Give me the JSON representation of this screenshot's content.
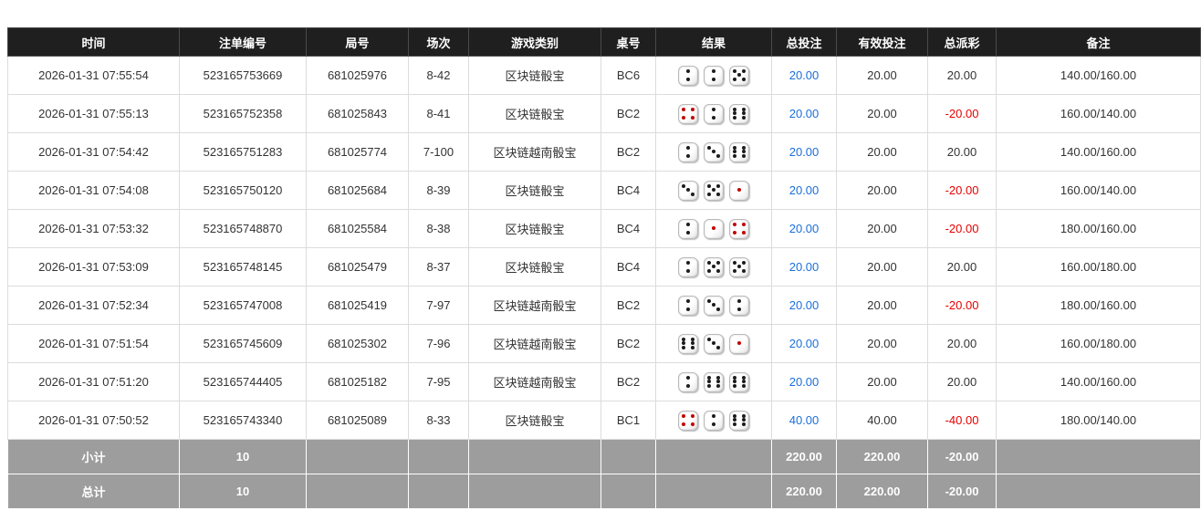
{
  "colors": {
    "header_bg": "#1f1f1f",
    "header_text": "#ffffff",
    "footer_bg": "#9d9d9d",
    "footer_text": "#ffffff",
    "bet_link_blue": "#1a6fd9",
    "negative_red": "#e60000",
    "body_text": "#333333"
  },
  "table": {
    "columns": [
      {
        "label": "时间"
      },
      {
        "label": "注单编号"
      },
      {
        "label": "局号"
      },
      {
        "label": "场次"
      },
      {
        "label": "游戏类别"
      },
      {
        "label": "桌号"
      },
      {
        "label": "结果"
      },
      {
        "label": "总投注"
      },
      {
        "label": "有效投注"
      },
      {
        "label": "总派彩"
      },
      {
        "label": "备注"
      }
    ],
    "rows": [
      {
        "time": "2026-01-31 07:55:54",
        "bet_id": "523165753669",
        "round_id": "681025976",
        "session": "8-42",
        "game_type": "区块链骰宝",
        "table_no": "BC6",
        "dice": [
          {
            "value": 2,
            "color": "black"
          },
          {
            "value": 2,
            "color": "black"
          },
          {
            "value": 5,
            "color": "black"
          }
        ],
        "total_bet": "20.00",
        "valid_bet": "20.00",
        "payout": "20.00",
        "remark": "140.00/160.00"
      },
      {
        "time": "2026-01-31 07:55:13",
        "bet_id": "523165752358",
        "round_id": "681025843",
        "session": "8-41",
        "game_type": "区块链骰宝",
        "table_no": "BC2",
        "dice": [
          {
            "value": 4,
            "color": "red"
          },
          {
            "value": 2,
            "color": "black"
          },
          {
            "value": 6,
            "color": "black"
          }
        ],
        "total_bet": "20.00",
        "valid_bet": "20.00",
        "payout": "-20.00",
        "remark": "160.00/140.00"
      },
      {
        "time": "2026-01-31 07:54:42",
        "bet_id": "523165751283",
        "round_id": "681025774",
        "session": "7-100",
        "game_type": "区块链越南骰宝",
        "table_no": "BC2",
        "dice": [
          {
            "value": 2,
            "color": "black"
          },
          {
            "value": 3,
            "color": "black"
          },
          {
            "value": 6,
            "color": "black"
          }
        ],
        "total_bet": "20.00",
        "valid_bet": "20.00",
        "payout": "20.00",
        "remark": "140.00/160.00"
      },
      {
        "time": "2026-01-31 07:54:08",
        "bet_id": "523165750120",
        "round_id": "681025684",
        "session": "8-39",
        "game_type": "区块链骰宝",
        "table_no": "BC4",
        "dice": [
          {
            "value": 3,
            "color": "black"
          },
          {
            "value": 5,
            "color": "black"
          },
          {
            "value": 1,
            "color": "red"
          }
        ],
        "total_bet": "20.00",
        "valid_bet": "20.00",
        "payout": "-20.00",
        "remark": "160.00/140.00"
      },
      {
        "time": "2026-01-31 07:53:32",
        "bet_id": "523165748870",
        "round_id": "681025584",
        "session": "8-38",
        "game_type": "区块链骰宝",
        "table_no": "BC4",
        "dice": [
          {
            "value": 2,
            "color": "black"
          },
          {
            "value": 1,
            "color": "red"
          },
          {
            "value": 4,
            "color": "red"
          }
        ],
        "total_bet": "20.00",
        "valid_bet": "20.00",
        "payout": "-20.00",
        "remark": "180.00/160.00"
      },
      {
        "time": "2026-01-31 07:53:09",
        "bet_id": "523165748145",
        "round_id": "681025479",
        "session": "8-37",
        "game_type": "区块链骰宝",
        "table_no": "BC4",
        "dice": [
          {
            "value": 2,
            "color": "black"
          },
          {
            "value": 5,
            "color": "black"
          },
          {
            "value": 5,
            "color": "black"
          }
        ],
        "total_bet": "20.00",
        "valid_bet": "20.00",
        "payout": "20.00",
        "remark": "160.00/180.00"
      },
      {
        "time": "2026-01-31 07:52:34",
        "bet_id": "523165747008",
        "round_id": "681025419",
        "session": "7-97",
        "game_type": "区块链越南骰宝",
        "table_no": "BC2",
        "dice": [
          {
            "value": 2,
            "color": "black"
          },
          {
            "value": 3,
            "color": "black"
          },
          {
            "value": 2,
            "color": "black"
          }
        ],
        "total_bet": "20.00",
        "valid_bet": "20.00",
        "payout": "-20.00",
        "remark": "180.00/160.00"
      },
      {
        "time": "2026-01-31 07:51:54",
        "bet_id": "523165745609",
        "round_id": "681025302",
        "session": "7-96",
        "game_type": "区块链越南骰宝",
        "table_no": "BC2",
        "dice": [
          {
            "value": 6,
            "color": "black"
          },
          {
            "value": 3,
            "color": "black"
          },
          {
            "value": 1,
            "color": "red"
          }
        ],
        "total_bet": "20.00",
        "valid_bet": "20.00",
        "payout": "20.00",
        "remark": "160.00/180.00"
      },
      {
        "time": "2026-01-31 07:51:20",
        "bet_id": "523165744405",
        "round_id": "681025182",
        "session": "7-95",
        "game_type": "区块链越南骰宝",
        "table_no": "BC2",
        "dice": [
          {
            "value": 2,
            "color": "black"
          },
          {
            "value": 6,
            "color": "black"
          },
          {
            "value": 6,
            "color": "black"
          }
        ],
        "total_bet": "20.00",
        "valid_bet": "20.00",
        "payout": "20.00",
        "remark": "140.00/160.00"
      },
      {
        "time": "2026-01-31 07:50:52",
        "bet_id": "523165743340",
        "round_id": "681025089",
        "session": "8-33",
        "game_type": "区块链骰宝",
        "table_no": "BC1",
        "dice": [
          {
            "value": 4,
            "color": "red"
          },
          {
            "value": 2,
            "color": "black"
          },
          {
            "value": 6,
            "color": "black"
          }
        ],
        "total_bet": "40.00",
        "valid_bet": "40.00",
        "payout": "-40.00",
        "remark": "180.00/140.00"
      }
    ],
    "footer_rows": [
      {
        "label": "小计",
        "count": "10",
        "total_bet": "220.00",
        "valid_bet": "220.00",
        "payout": "-20.00",
        "remark": ""
      },
      {
        "label": "总计",
        "count": "10",
        "total_bet": "220.00",
        "valid_bet": "220.00",
        "payout": "-20.00",
        "remark": ""
      }
    ]
  }
}
